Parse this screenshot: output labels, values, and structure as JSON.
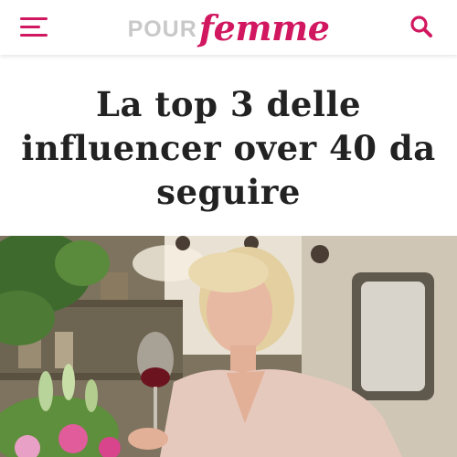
{
  "header": {
    "logo_pour": "POUR",
    "logo_femme": "femme",
    "brand_color": "#d1175f",
    "menu_icon": "hamburger-menu-icon",
    "search_icon": "search-icon"
  },
  "article": {
    "title": "La top 3 delle influencer over 40 da seguire"
  }
}
